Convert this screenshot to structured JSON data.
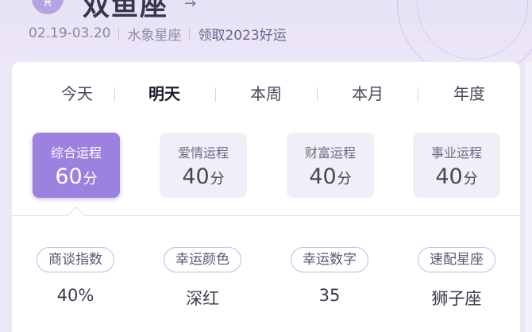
{
  "header": {
    "sign_icon": "♓",
    "sign_icon_name": "pisces-symbol-icon",
    "sign_name": "双鱼座",
    "arrow": "→",
    "date_range": "02.19-03.20",
    "element": "水象星座",
    "promo_link": "领取2023好运"
  },
  "tabs": [
    {
      "label": "今天"
    },
    {
      "label": "明天",
      "active": true
    },
    {
      "label": "本周"
    },
    {
      "label": "本月"
    },
    {
      "label": "年度"
    }
  ],
  "scores": [
    {
      "label": "综合运程",
      "value": "60",
      "unit": "分",
      "active": true
    },
    {
      "label": "爱情运程",
      "value": "40",
      "unit": "分"
    },
    {
      "label": "财富运程",
      "value": "40",
      "unit": "分"
    },
    {
      "label": "事业运程",
      "value": "40",
      "unit": "分"
    }
  ],
  "info": [
    {
      "label": "商谈指数",
      "value": "40%"
    },
    {
      "label": "幸运颜色",
      "value": "深红"
    },
    {
      "label": "幸运数字",
      "value": "35"
    },
    {
      "label": "速配星座",
      "value": "狮子座"
    }
  ],
  "colors": {
    "accent": "#9d81de",
    "background": "#ece8f6",
    "card": "#ffffff"
  }
}
